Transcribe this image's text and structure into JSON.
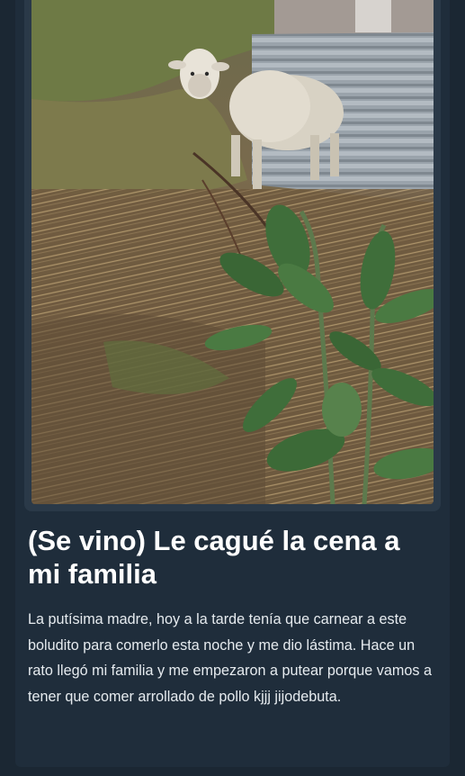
{
  "post": {
    "title": "(Se vino) Le cagué la cena a mi familia",
    "body": "La putísima madre, hoy a la tarde tenía que carnear a este boludito para comerlo esta noche y me dio lástima. Hace un rato llegó mi familia y me empezaron a putear porque vamos a tener que comer arrollado de pollo kjjj jijodebuta."
  },
  "photo": {
    "subject": "sheep-in-yard",
    "colors": {
      "grass": "#6e7a45",
      "straw": "#8a7350",
      "corrugated_metal": "#9aa3ab",
      "wool": "#d8d2c4",
      "plant_leaf": "#3f6e3a"
    }
  },
  "colors": {
    "background": "#1b2733",
    "card": "#1f2d3b",
    "title_text": "#ffffff",
    "body_text": "#e6ebef"
  }
}
